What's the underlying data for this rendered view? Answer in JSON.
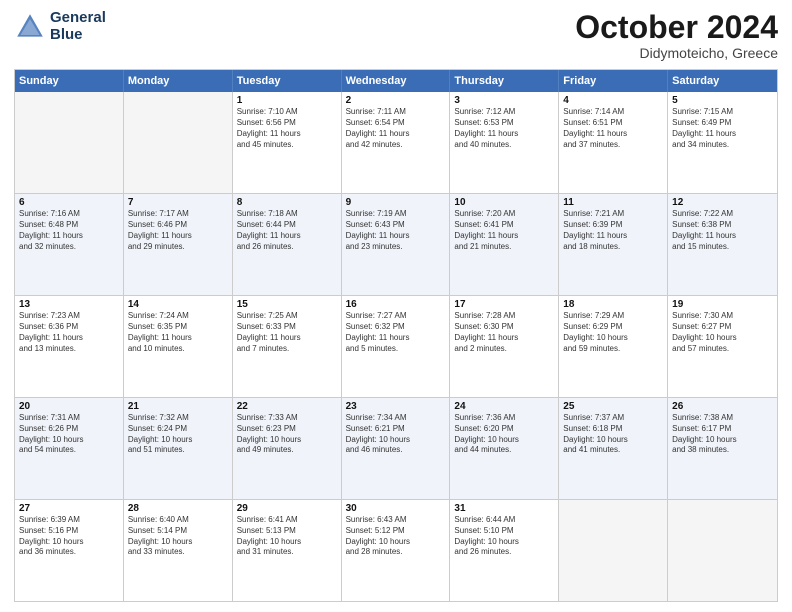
{
  "header": {
    "logo_line1": "General",
    "logo_line2": "Blue",
    "month": "October 2024",
    "location": "Didymoteicho, Greece"
  },
  "days": [
    "Sunday",
    "Monday",
    "Tuesday",
    "Wednesday",
    "Thursday",
    "Friday",
    "Saturday"
  ],
  "rows": [
    [
      {
        "day": "",
        "text": ""
      },
      {
        "day": "",
        "text": ""
      },
      {
        "day": "1",
        "text": "Sunrise: 7:10 AM\nSunset: 6:56 PM\nDaylight: 11 hours\nand 45 minutes."
      },
      {
        "day": "2",
        "text": "Sunrise: 7:11 AM\nSunset: 6:54 PM\nDaylight: 11 hours\nand 42 minutes."
      },
      {
        "day": "3",
        "text": "Sunrise: 7:12 AM\nSunset: 6:53 PM\nDaylight: 11 hours\nand 40 minutes."
      },
      {
        "day": "4",
        "text": "Sunrise: 7:14 AM\nSunset: 6:51 PM\nDaylight: 11 hours\nand 37 minutes."
      },
      {
        "day": "5",
        "text": "Sunrise: 7:15 AM\nSunset: 6:49 PM\nDaylight: 11 hours\nand 34 minutes."
      }
    ],
    [
      {
        "day": "6",
        "text": "Sunrise: 7:16 AM\nSunset: 6:48 PM\nDaylight: 11 hours\nand 32 minutes."
      },
      {
        "day": "7",
        "text": "Sunrise: 7:17 AM\nSunset: 6:46 PM\nDaylight: 11 hours\nand 29 minutes."
      },
      {
        "day": "8",
        "text": "Sunrise: 7:18 AM\nSunset: 6:44 PM\nDaylight: 11 hours\nand 26 minutes."
      },
      {
        "day": "9",
        "text": "Sunrise: 7:19 AM\nSunset: 6:43 PM\nDaylight: 11 hours\nand 23 minutes."
      },
      {
        "day": "10",
        "text": "Sunrise: 7:20 AM\nSunset: 6:41 PM\nDaylight: 11 hours\nand 21 minutes."
      },
      {
        "day": "11",
        "text": "Sunrise: 7:21 AM\nSunset: 6:39 PM\nDaylight: 11 hours\nand 18 minutes."
      },
      {
        "day": "12",
        "text": "Sunrise: 7:22 AM\nSunset: 6:38 PM\nDaylight: 11 hours\nand 15 minutes."
      }
    ],
    [
      {
        "day": "13",
        "text": "Sunrise: 7:23 AM\nSunset: 6:36 PM\nDaylight: 11 hours\nand 13 minutes."
      },
      {
        "day": "14",
        "text": "Sunrise: 7:24 AM\nSunset: 6:35 PM\nDaylight: 11 hours\nand 10 minutes."
      },
      {
        "day": "15",
        "text": "Sunrise: 7:25 AM\nSunset: 6:33 PM\nDaylight: 11 hours\nand 7 minutes."
      },
      {
        "day": "16",
        "text": "Sunrise: 7:27 AM\nSunset: 6:32 PM\nDaylight: 11 hours\nand 5 minutes."
      },
      {
        "day": "17",
        "text": "Sunrise: 7:28 AM\nSunset: 6:30 PM\nDaylight: 11 hours\nand 2 minutes."
      },
      {
        "day": "18",
        "text": "Sunrise: 7:29 AM\nSunset: 6:29 PM\nDaylight: 10 hours\nand 59 minutes."
      },
      {
        "day": "19",
        "text": "Sunrise: 7:30 AM\nSunset: 6:27 PM\nDaylight: 10 hours\nand 57 minutes."
      }
    ],
    [
      {
        "day": "20",
        "text": "Sunrise: 7:31 AM\nSunset: 6:26 PM\nDaylight: 10 hours\nand 54 minutes."
      },
      {
        "day": "21",
        "text": "Sunrise: 7:32 AM\nSunset: 6:24 PM\nDaylight: 10 hours\nand 51 minutes."
      },
      {
        "day": "22",
        "text": "Sunrise: 7:33 AM\nSunset: 6:23 PM\nDaylight: 10 hours\nand 49 minutes."
      },
      {
        "day": "23",
        "text": "Sunrise: 7:34 AM\nSunset: 6:21 PM\nDaylight: 10 hours\nand 46 minutes."
      },
      {
        "day": "24",
        "text": "Sunrise: 7:36 AM\nSunset: 6:20 PM\nDaylight: 10 hours\nand 44 minutes."
      },
      {
        "day": "25",
        "text": "Sunrise: 7:37 AM\nSunset: 6:18 PM\nDaylight: 10 hours\nand 41 minutes."
      },
      {
        "day": "26",
        "text": "Sunrise: 7:38 AM\nSunset: 6:17 PM\nDaylight: 10 hours\nand 38 minutes."
      }
    ],
    [
      {
        "day": "27",
        "text": "Sunrise: 6:39 AM\nSunset: 5:16 PM\nDaylight: 10 hours\nand 36 minutes."
      },
      {
        "day": "28",
        "text": "Sunrise: 6:40 AM\nSunset: 5:14 PM\nDaylight: 10 hours\nand 33 minutes."
      },
      {
        "day": "29",
        "text": "Sunrise: 6:41 AM\nSunset: 5:13 PM\nDaylight: 10 hours\nand 31 minutes."
      },
      {
        "day": "30",
        "text": "Sunrise: 6:43 AM\nSunset: 5:12 PM\nDaylight: 10 hours\nand 28 minutes."
      },
      {
        "day": "31",
        "text": "Sunrise: 6:44 AM\nSunset: 5:10 PM\nDaylight: 10 hours\nand 26 minutes."
      },
      {
        "day": "",
        "text": ""
      },
      {
        "day": "",
        "text": ""
      }
    ]
  ]
}
